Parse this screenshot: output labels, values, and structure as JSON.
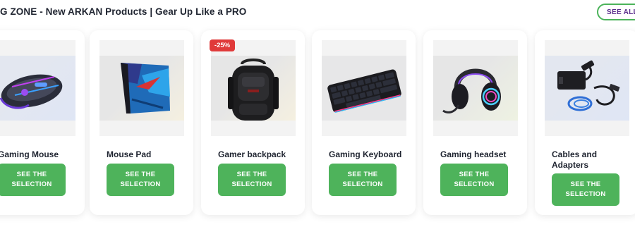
{
  "header": {
    "title": "G ZONE - New ARKAN Products | Gear Up Like a PRO",
    "see_all_label": "SEE ALL"
  },
  "cards": [
    {
      "label": "Gaming Mouse",
      "cta": "SEE THE SELECTION",
      "icon": "mouse-icon"
    },
    {
      "label": "Mouse Pad",
      "cta": "SEE THE SELECTION",
      "icon": "mouse-pad-icon"
    },
    {
      "label": "Gamer backpack",
      "cta": "SEE THE SELECTION",
      "icon": "backpack-icon",
      "badge": "-25%"
    },
    {
      "label": "Gaming Keyboard",
      "cta": "SEE THE SELECTION",
      "icon": "keyboard-icon"
    },
    {
      "label": "Gaming headset",
      "cta": "SEE THE SELECTION",
      "icon": "headset-icon"
    },
    {
      "label": "Cables and Adapters",
      "cta": "SEE THE SELECTION",
      "icon": "cables-icon"
    }
  ],
  "colors": {
    "cta_green": "#4eb35b",
    "badge_red": "#e03a3a",
    "see_all_text": "#5a2d8c",
    "see_all_border": "#4bb35a"
  }
}
